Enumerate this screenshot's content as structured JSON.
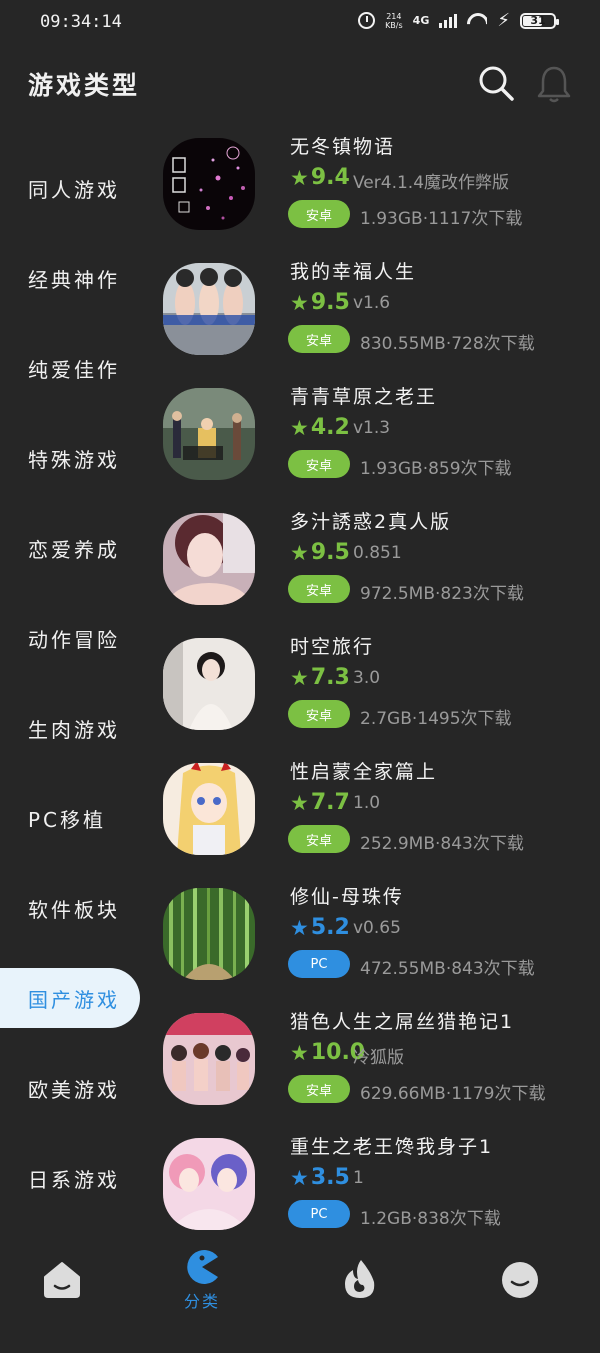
{
  "status_bar": {
    "time": "09:34:14",
    "speed_value": "214",
    "speed_unit": "KB/s",
    "network": "4G",
    "battery": "31"
  },
  "header": {
    "title": "游戏类型"
  },
  "sidebar": {
    "items": [
      {
        "label": "同人游戏",
        "active": false
      },
      {
        "label": "经典神作",
        "active": false
      },
      {
        "label": "纯爱佳作",
        "active": false
      },
      {
        "label": "特殊游戏",
        "active": false
      },
      {
        "label": "恋爱养成",
        "active": false
      },
      {
        "label": "动作冒险",
        "active": false
      },
      {
        "label": "生肉游戏",
        "active": false
      },
      {
        "label": "PC移植",
        "active": false
      },
      {
        "label": "软件板块",
        "active": false
      },
      {
        "label": "国产游戏",
        "active": true
      },
      {
        "label": "欧美游戏",
        "active": false
      },
      {
        "label": "日系游戏",
        "active": false
      }
    ]
  },
  "games": [
    {
      "title": "无冬镇物语",
      "rating": "9.4",
      "version": "Ver4.1.4魔改作弊版",
      "platform": "安卓",
      "meta": "1.93GB·1117次下载",
      "accent": "#7cc043"
    },
    {
      "title": "我的幸福人生",
      "rating": "9.5",
      "version": "v1.6",
      "platform": "安卓",
      "meta": "830.55MB·728次下载",
      "accent": "#7cc043"
    },
    {
      "title": "青青草原之老王",
      "rating": "4.2",
      "version": "v1.3",
      "platform": "安卓",
      "meta": "1.93GB·859次下载",
      "accent": "#7cc043"
    },
    {
      "title": "多汁誘惑2真人版",
      "rating": "9.5",
      "version": "0.851",
      "platform": "安卓",
      "meta": "972.5MB·823次下载",
      "accent": "#7cc043"
    },
    {
      "title": "时空旅行",
      "rating": "7.3",
      "version": "3.0",
      "platform": "安卓",
      "meta": "2.7GB·1495次下载",
      "accent": "#7cc043"
    },
    {
      "title": "性启蒙全家篇上",
      "rating": "7.7",
      "version": "1.0",
      "platform": "安卓",
      "meta": "252.9MB·843次下载",
      "accent": "#7cc043"
    },
    {
      "title": "修仙-母珠传",
      "rating": "5.2",
      "version": "v0.65",
      "platform": "PC",
      "meta": "472.55MB·843次下载",
      "accent": "#2f8fe0"
    },
    {
      "title": "猎色人生之屌丝猎艳记1",
      "rating": "10.0",
      "version": "冷狐版",
      "platform": "安卓",
      "meta": "629.66MB·1179次下载",
      "accent": "#7cc043"
    },
    {
      "title": "重生之老王馋我身子1",
      "rating": "3.5",
      "version": "1",
      "platform": "PC",
      "meta": "1.2GB·838次下载",
      "accent": "#2f8fe0"
    }
  ],
  "bottom_nav": {
    "items": [
      {
        "icon": "home-icon",
        "label": ""
      },
      {
        "icon": "category-icon",
        "label": "分类"
      },
      {
        "icon": "fire-icon",
        "label": ""
      },
      {
        "icon": "profile-icon",
        "label": ""
      }
    ]
  },
  "colors": {
    "background": "#262626",
    "android_green": "#7cc043",
    "pc_blue": "#2f8fe0",
    "active_bg": "#e8f3fb"
  }
}
